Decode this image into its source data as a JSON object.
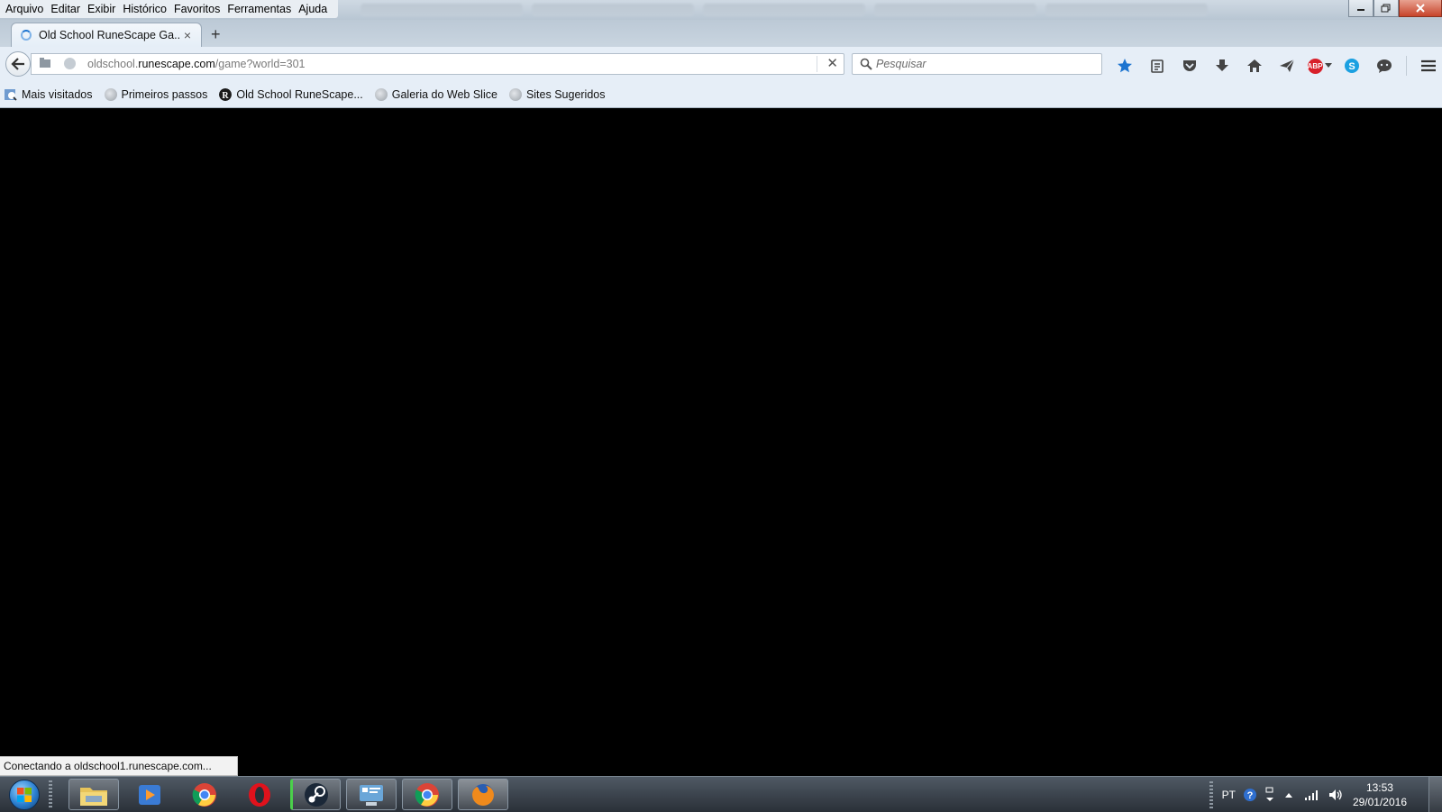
{
  "menu": [
    "Arquivo",
    "Editar",
    "Exibir",
    "Histórico",
    "Favoritos",
    "Ferramentas",
    "Ajuda"
  ],
  "tab": {
    "title": "Old School RuneScape Ga...",
    "close": "×"
  },
  "newtab": "+",
  "url": {
    "prefix": "oldschool.",
    "domain": "runescape.com",
    "path": "/game?world=301",
    "clear": "✕"
  },
  "search": {
    "placeholder": "Pesquisar"
  },
  "bookmarks": [
    {
      "label": "Mais visitados",
      "icon": "most-visited-icon"
    },
    {
      "label": "Primeiros passos",
      "icon": "globe-icon"
    },
    {
      "label": "Old School RuneScape...",
      "icon": "runescape-icon"
    },
    {
      "label": "Galeria do Web Slice",
      "icon": "globe-icon"
    },
    {
      "label": "Sites Sugeridos",
      "icon": "globe-icon"
    }
  ],
  "status": "Conectando a oldschool1.runescape.com...",
  "tray": {
    "language": "PT",
    "time": "13:53",
    "date": "29/01/2016"
  },
  "colors": {
    "accent": "#1c74d0",
    "abp": "#d8202a",
    "content": "#000000"
  }
}
